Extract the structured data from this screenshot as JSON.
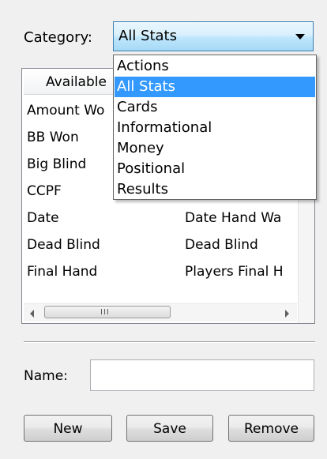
{
  "category": {
    "label": "Category:",
    "selected": "All Stats",
    "options": [
      "Actions",
      "All Stats",
      "Cards",
      "Informational",
      "Money",
      "Positional",
      "Results"
    ],
    "selected_index": 1
  },
  "list": {
    "column_header": "Available",
    "rows": [
      {
        "col1": "Amount Wo",
        "col2": ""
      },
      {
        "col1": "BB Won",
        "col2": ""
      },
      {
        "col1": "Big Blind",
        "col2": ""
      },
      {
        "col1": "CCPF",
        "col2": ""
      },
      {
        "col1": "Date",
        "col2": "Date Hand Wa"
      },
      {
        "col1": "Dead Blind",
        "col2": "Dead Blind"
      },
      {
        "col1": "Final Hand",
        "col2": "Players Final H"
      }
    ],
    "hscroll_grip": "III"
  },
  "name": {
    "label": "Name:",
    "value": ""
  },
  "buttons": {
    "new": "New",
    "save": "Save",
    "remove": "Remove"
  }
}
